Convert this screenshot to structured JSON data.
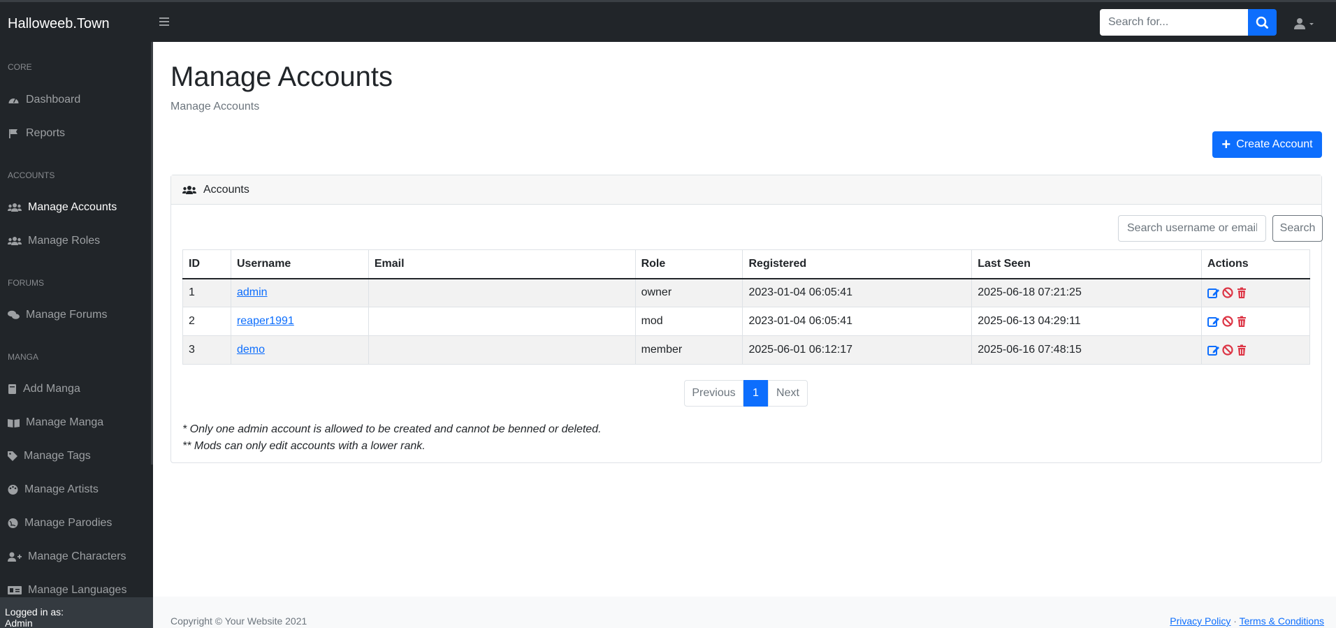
{
  "navbar": {
    "brand": "Halloweeb.Town",
    "search_placeholder": "Search for..."
  },
  "sidebar": {
    "sections": [
      {
        "heading": "Core",
        "items": [
          {
            "label": "Dashboard",
            "icon": "gauge-icon"
          },
          {
            "label": "Reports",
            "icon": "flag-icon"
          }
        ]
      },
      {
        "heading": "Accounts",
        "items": [
          {
            "label": "Manage Accounts",
            "icon": "users-icon"
          },
          {
            "label": "Manage Roles",
            "icon": "users-icon"
          }
        ]
      },
      {
        "heading": "Forums",
        "items": [
          {
            "label": "Manage Forums",
            "icon": "comments-icon"
          }
        ]
      },
      {
        "heading": "Manga",
        "items": [
          {
            "label": "Add Manga",
            "icon": "book-icon"
          },
          {
            "label": "Manage Manga",
            "icon": "book-open-icon"
          },
          {
            "label": "Manage Tags",
            "icon": "tag-icon"
          },
          {
            "label": "Manage Artists",
            "icon": "palette-icon"
          },
          {
            "label": "Manage Parodies",
            "icon": "globe-icon"
          },
          {
            "label": "Manage Characters",
            "icon": "user-plus-icon"
          },
          {
            "label": "Manage Languages",
            "icon": "language-icon"
          }
        ]
      }
    ],
    "footer_label": "Logged in as:",
    "footer_user": "Admin"
  },
  "page": {
    "title": "Manage Accounts",
    "breadcrumb": "Manage Accounts",
    "create_button": "Create Account"
  },
  "card": {
    "header": "Accounts",
    "search_placeholder": "Search username or email...",
    "search_button": "Search"
  },
  "table": {
    "headers": [
      "ID",
      "Username",
      "Email",
      "Role",
      "Registered",
      "Last Seen",
      "Actions"
    ],
    "rows": [
      {
        "id": "1",
        "username": "admin",
        "email": "",
        "role": "owner",
        "registered": "2023-01-04 06:05:41",
        "last_seen": "2025-06-18 07:21:25"
      },
      {
        "id": "2",
        "username": "reaper1991",
        "email": "",
        "role": "mod",
        "registered": "2023-01-04 06:05:41",
        "last_seen": "2025-06-13 04:29:11"
      },
      {
        "id": "3",
        "username": "demo",
        "email": "",
        "role": "member",
        "registered": "2025-06-01 06:12:17",
        "last_seen": "2025-06-16 07:48:15"
      }
    ]
  },
  "pagination": {
    "previous": "Previous",
    "current": "1",
    "next": "Next"
  },
  "notes": [
    "* Only one admin account is allowed to be created and cannot be benned or deleted.",
    "** Mods can only edit accounts with a lower rank."
  ],
  "footer": {
    "copyright": "Copyright © Your Website 2021",
    "privacy": "Privacy Policy",
    "separator": "·",
    "terms": "Terms & Conditions"
  },
  "colors": {
    "primary": "#0d6efd",
    "danger": "#dc3545",
    "dark": "#212529"
  }
}
